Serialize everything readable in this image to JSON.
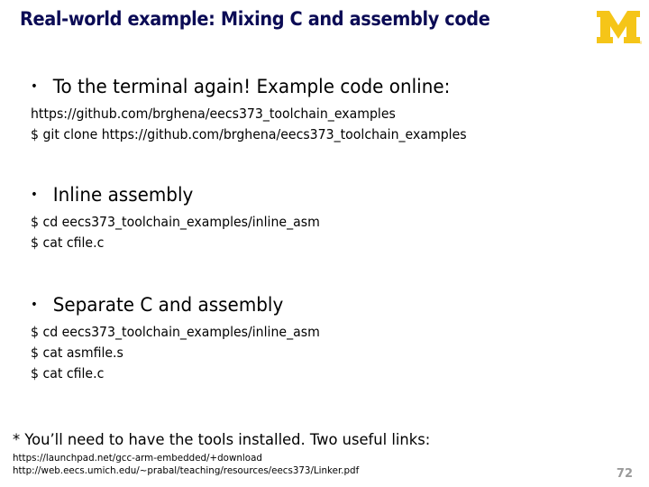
{
  "slide": {
    "title": "Real-world example: Mixing C and assembly code",
    "logo": {
      "icon": "university-of-michigan-block-m-icon",
      "color": "#f5c518"
    },
    "title_color": "#0b0b55",
    "sections": [
      {
        "bullet": "To the terminal again!  Example code online:",
        "lines": [
          "https://github.com/brghena/eecs373_toolchain_examples",
          "$ git clone https://github.com/brghena/eecs373_toolchain_examples"
        ]
      },
      {
        "bullet": "Inline assembly",
        "lines": [
          "$ cd eecs373_toolchain_examples/inline_asm",
          "$ cat cfile.c"
        ]
      },
      {
        "bullet": "Separate C and assembly",
        "lines": [
          "$ cd eecs373_toolchain_examples/inline_asm",
          "$ cat asmfile.s",
          "$ cat cfile.c"
        ]
      }
    ],
    "footnote": "* You’ll need to have the tools installed.  Two useful links:",
    "links": [
      "https://launchpad.net/gcc-arm-embedded/+download",
      "http://web.eecs.umich.edu/~prabal/teaching/resources/eecs373/Linker.pdf"
    ],
    "page_number": "72",
    "bullet_glyph": "•"
  }
}
